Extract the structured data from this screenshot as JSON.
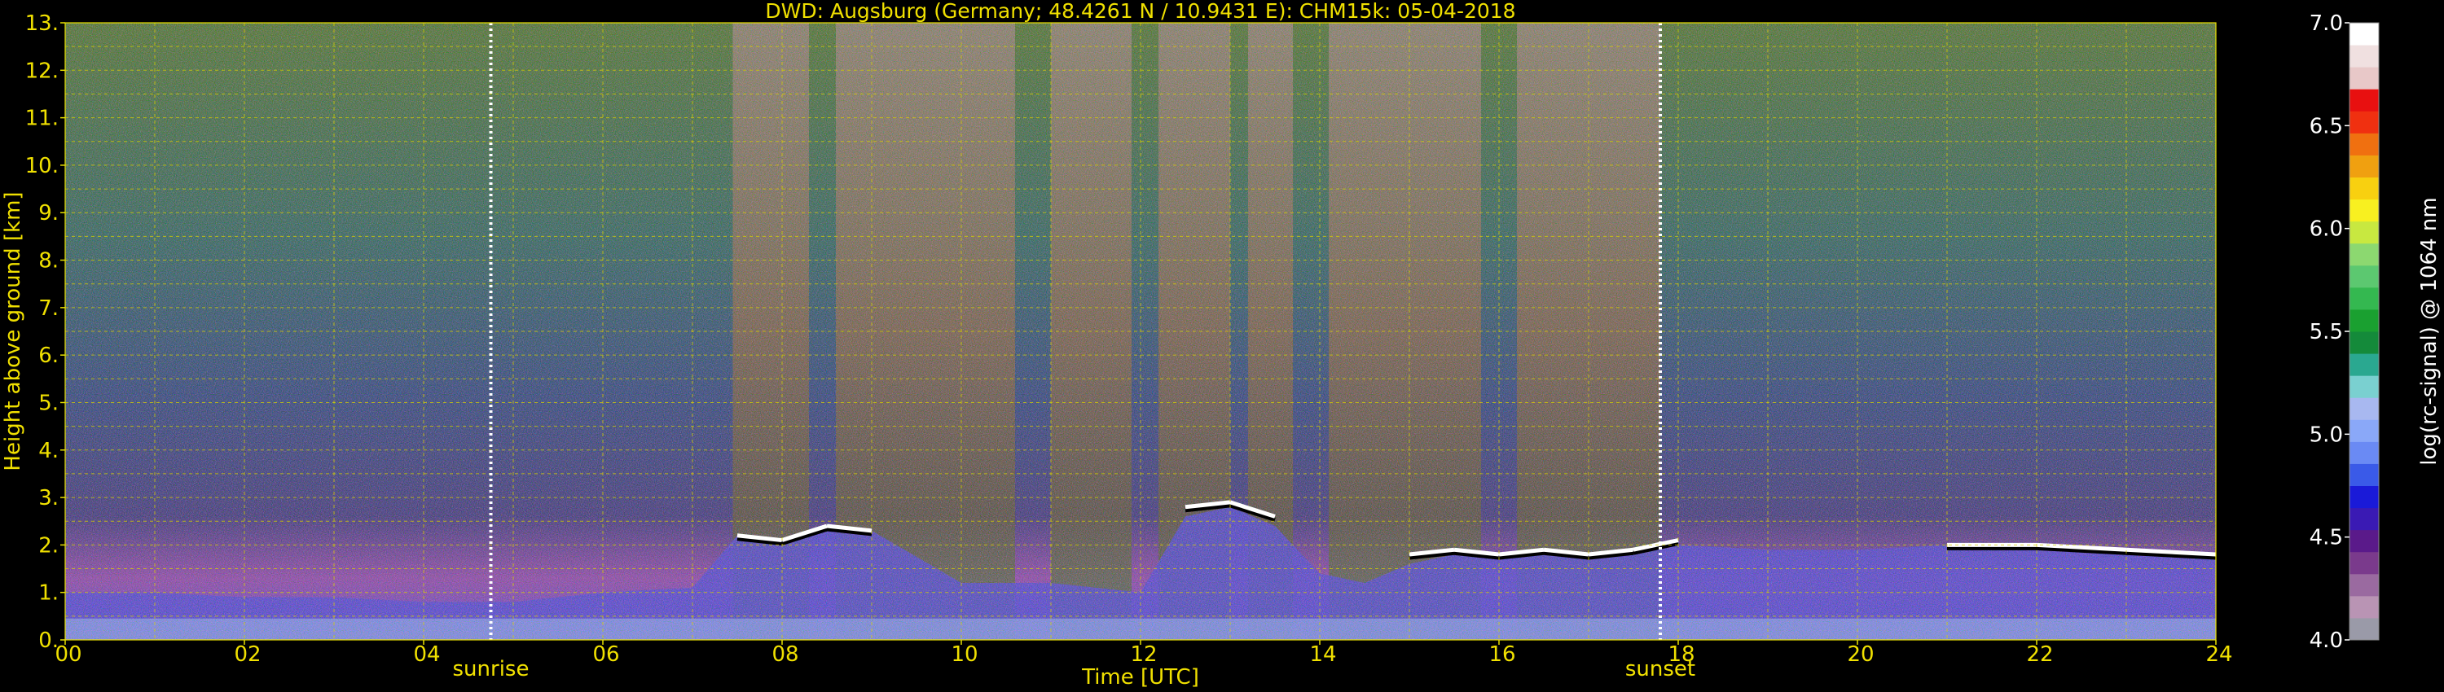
{
  "chart_data": {
    "type": "heatmap",
    "title": "DWD: Augsburg (Germany; 48.4261 N / 10.9431 E):    CHM15k: 05-04-2018",
    "xlabel": "Time [UTC]",
    "ylabel": "Height above ground [km]",
    "xlim": [
      0,
      24
    ],
    "ylim": [
      0,
      13
    ],
    "x_ticks": [
      "00",
      "02",
      "04",
      "06",
      "08",
      "10",
      "12",
      "14",
      "16",
      "18",
      "20",
      "22",
      "24"
    ],
    "y_ticks": [
      "0.",
      "1.",
      "2.",
      "3.",
      "4.",
      "5.",
      "6.",
      "7.",
      "8.",
      "9.",
      "10.",
      "11.",
      "12.",
      "13."
    ],
    "grid": true,
    "events": [
      {
        "label": "sunrise",
        "time_utc": 4.75
      },
      {
        "label": "sunset",
        "time_utc": 17.8
      }
    ],
    "colorbar": {
      "label": "log(rc-signal) @ 1064 nm",
      "range": [
        4.0,
        7.0
      ],
      "ticks": [
        "4.0",
        "4.5",
        "5.0",
        "5.5",
        "6.0",
        "6.5",
        "7.0"
      ],
      "colors": [
        "#9a9aa8",
        "#b994b4",
        "#9a6aa0",
        "#7a3a8c",
        "#5a1a8a",
        "#3a1ab4",
        "#1a1ad8",
        "#3a5ae8",
        "#6a8af4",
        "#8aa8f8",
        "#a8b8f0",
        "#7ad0d0",
        "#2aa890",
        "#148a3a",
        "#1aa030",
        "#34b850",
        "#5cc870",
        "#8cd870",
        "#c8e840",
        "#f8f020",
        "#f8d010",
        "#f0a010",
        "#f07010",
        "#f03010",
        "#e81010",
        "#e8c8c8",
        "#f0e0e0",
        "#ffffff"
      ]
    },
    "signal_profile": {
      "hours": [
        0,
        1,
        2,
        3,
        4,
        5,
        6,
        7,
        7.5,
        8,
        8.5,
        9,
        10,
        11,
        12,
        12.5,
        13,
        13.5,
        14,
        14.5,
        15,
        15.5,
        16,
        16.5,
        17,
        17.5,
        18,
        19,
        20,
        21,
        22,
        23,
        24
      ],
      "boundary_layer_top_km": [
        1.0,
        1.0,
        0.9,
        0.9,
        0.8,
        0.8,
        1.0,
        1.1,
        2.2,
        2.1,
        2.3,
        2.3,
        1.2,
        1.2,
        1.0,
        2.6,
        2.8,
        2.4,
        1.4,
        1.2,
        1.6,
        1.8,
        1.7,
        1.8,
        1.8,
        1.8,
        2.0,
        1.9,
        1.9,
        2.0,
        2.0,
        1.9,
        1.8
      ],
      "cloud_base_km": [
        null,
        null,
        null,
        null,
        null,
        null,
        null,
        null,
        2.2,
        2.1,
        2.4,
        2.3,
        null,
        null,
        null,
        2.8,
        2.9,
        2.6,
        null,
        null,
        1.8,
        1.9,
        1.8,
        1.9,
        1.8,
        1.9,
        2.1,
        null,
        null,
        2.0,
        2.0,
        1.9,
        1.8
      ]
    }
  }
}
